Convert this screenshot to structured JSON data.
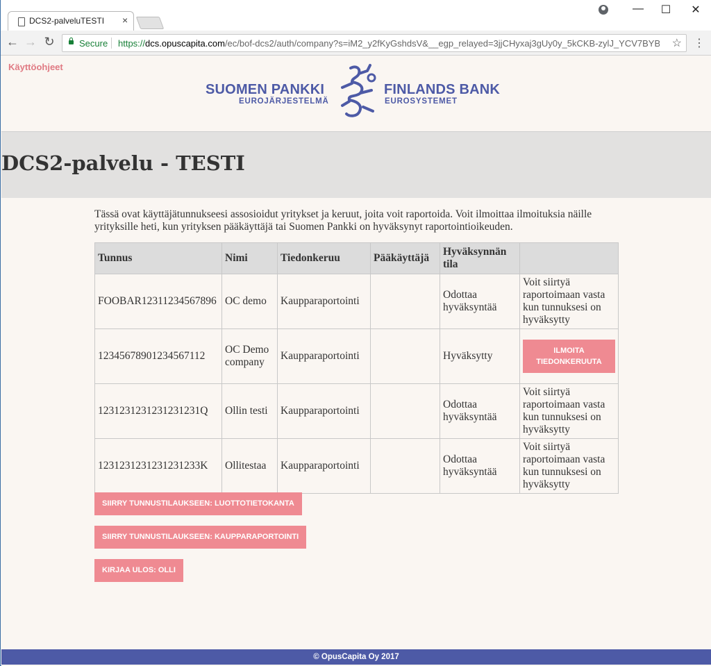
{
  "browser": {
    "tab_title": "DCS2-palveluTESTI",
    "tab_close": "×",
    "secure_label": "Secure",
    "url_scheme": "https://",
    "url_host": "dcs.opuscapita.com",
    "url_rest": "/ec/bof-dcs2/auth/company?s=iM2_y2fKyGshdsV&__egp_relayed=3jjCHyxaj3gUy0y_5kCKB-zylJ_YCV7BYBT...",
    "icons": [
      "page-icon",
      "back-icon",
      "forward-icon",
      "reload-icon",
      "lock-icon",
      "star-icon",
      "menu-icon",
      "account-icon",
      "minimize-icon",
      "maximize-icon",
      "close-icon"
    ]
  },
  "header": {
    "help_link": "Käyttöohjeet",
    "logo_fi_big": "SUOMEN PANKKI",
    "logo_fi_small": "EUROJÄRJESTELMÄ",
    "logo_sv_big": "FINLANDS BANK",
    "logo_sv_small": "EUROSYSTEMET"
  },
  "main": {
    "title": "DCS2-palvelu - TESTI",
    "intro": "Tässä ovat käyttäjätunnukseesi assosioidut yritykset ja keruut, joita voit raportoida. Voit ilmoittaa ilmoituksia näille yrityksille heti, kun yrityksen pääkäyttäjä tai Suomen Pankki on hyväksynyt raportointioikeuden.",
    "table": {
      "headers": [
        "Tunnus",
        "Nimi",
        "Tiedonkeruu",
        "Pääkäyttäjä",
        "Hyväksynnän tila",
        ""
      ],
      "rows": [
        {
          "tunnus": "FOOBAR12311234567896",
          "nimi": "OC demo",
          "tiedonkeruu": "Kaupparaportointi",
          "paakayttaja": "",
          "tila": "Odottaa hyväksyntää",
          "action": "Voit siirtyä raportoimaan vasta kun tunnuksesi on hyväksytty"
        },
        {
          "tunnus": "12345678901234567112",
          "nimi": "OC Demo company",
          "tiedonkeruu": "Kaupparaportointi",
          "paakayttaja": "",
          "tila": "Hyväksytty",
          "action_button": "ILMOITA TIEDONKERUUTA"
        },
        {
          "tunnus": "1231231231231231231Q",
          "nimi": "Ollin testi",
          "tiedonkeruu": "Kaupparaportointi",
          "paakayttaja": "",
          "tila": "Odottaa hyväksyntää",
          "action": "Voit siirtyä raportoimaan vasta kun tunnuksesi on hyväksytty"
        },
        {
          "tunnus": "1231231231231231233K",
          "nimi": "Ollitestaa",
          "tiedonkeruu": "Kaupparaportointi",
          "paakayttaja": "",
          "tila": "Odottaa hyväksyntää",
          "action": "Voit siirtyä raportoimaan vasta kun tunnuksesi on hyväksytty"
        }
      ]
    },
    "buttons": {
      "luottotieto": "SIIRRY TUNNUSTILAUKSEEN: LUOTTOTIETOKANTA",
      "kauppa": "SIIRRY TUNNUSTILAUKSEEN: KAUPPARAPORTOINTI",
      "logout": "KIRJAA ULOS: OLLI"
    }
  },
  "footer": {
    "text": "© OpusCapita Oy 2017"
  },
  "colors": {
    "accent": "#ef8a92",
    "brand": "#4d5aa6",
    "title_band": "#e2e1e0",
    "background": "#faf6f2"
  }
}
